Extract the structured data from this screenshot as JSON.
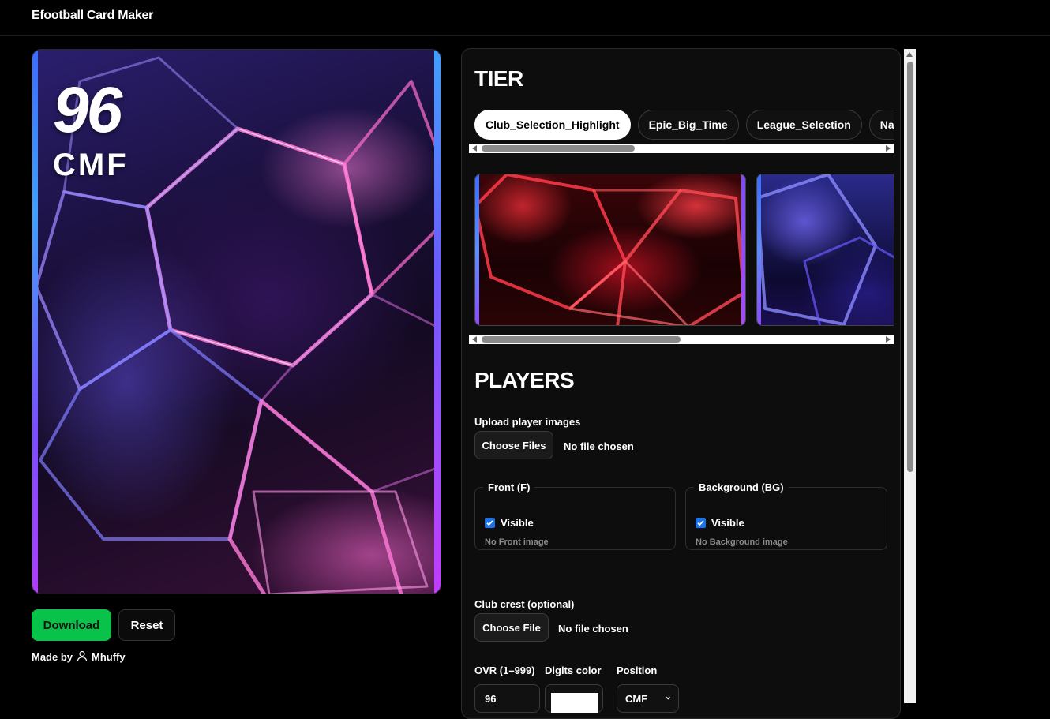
{
  "app": {
    "title": "Efootball Card Maker"
  },
  "card": {
    "ovr": "96",
    "position": "CMF"
  },
  "actions": {
    "download_label": "Download",
    "reset_label": "Reset"
  },
  "footer": {
    "made_by_label": "Made by",
    "author": "Mhuffy"
  },
  "tier": {
    "heading": "TIER",
    "options": [
      "Club_Selection_Highlight",
      "Epic_Big_Time",
      "League_Selection",
      "Nati"
    ],
    "selected": "Club_Selection_Highlight"
  },
  "players": {
    "heading": "PLAYERS",
    "upload_label": "Upload player images",
    "choose_files_label": "Choose Files",
    "no_file_text": "No file chosen",
    "front": {
      "legend": "Front (F)",
      "visible_label": "Visible",
      "visible": true,
      "empty_text": "No Front image"
    },
    "background": {
      "legend": "Background (BG)",
      "visible_label": "Visible",
      "visible": true,
      "empty_text": "No Background image"
    },
    "crest_label": "Club crest (optional)",
    "choose_file_label": "Choose File",
    "crest_no_file_text": "No file chosen",
    "ovr_label": "OVR (1–999)",
    "ovr_value": "96",
    "digits_color_label": "Digits color",
    "digits_color": "#ffffff",
    "position_label": "Position",
    "position_value": "CMF"
  },
  "colors": {
    "accent_green": "#08c249",
    "checkbox_blue": "#1a73e8"
  }
}
